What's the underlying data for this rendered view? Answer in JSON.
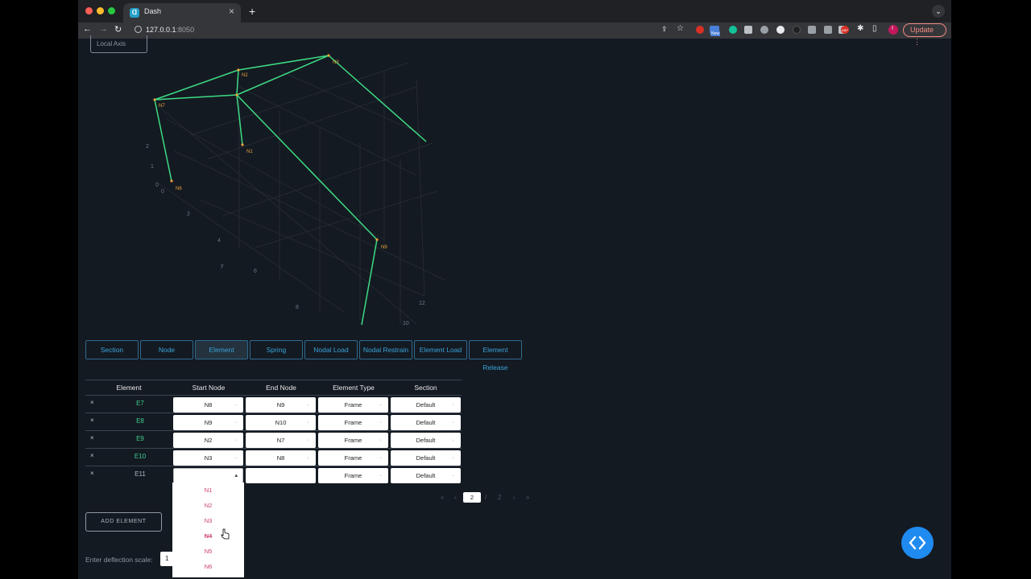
{
  "browser": {
    "tab_title": "Dash",
    "tab_favicon": "Dash",
    "url_host": "127.0.0.1",
    "url_port": ":8050",
    "update_label": "Update",
    "profile_initial": "I",
    "new_badge": "New",
    "abp_badge": "ABP"
  },
  "app": {
    "local_axis_label": "Local Axis",
    "tabs": [
      {
        "label": "Section"
      },
      {
        "label": "Node"
      },
      {
        "label": "Element"
      },
      {
        "label": "Spring"
      },
      {
        "label": "Nodal Load"
      },
      {
        "label": "Nodal Restrain"
      },
      {
        "label": "Element Load"
      },
      {
        "label": "Element Release"
      }
    ],
    "active_tab": "Element",
    "table": {
      "headers": [
        "Element",
        "Start Node",
        "End Node",
        "Element Type",
        "Section"
      ],
      "rows": [
        {
          "element": "E7",
          "start": "N8",
          "end": "N9",
          "type": "Frame",
          "section": "Default"
        },
        {
          "element": "E8",
          "start": "N9",
          "end": "N10",
          "type": "Frame",
          "section": "Default"
        },
        {
          "element": "E9",
          "start": "N2",
          "end": "N7",
          "type": "Frame",
          "section": "Default"
        },
        {
          "element": "E10",
          "start": "N3",
          "end": "N8",
          "type": "Frame",
          "section": "Default"
        },
        {
          "element": "E11",
          "start": "",
          "end": "",
          "type": "Frame",
          "section": "Default"
        }
      ],
      "delete_glyph": "×"
    },
    "dropdown_options": [
      "N1",
      "N2",
      "N3",
      "N4",
      "N5",
      "N6"
    ],
    "pagination": {
      "current_page": "2",
      "first": "«",
      "prev": "‹",
      "slash": "/",
      "total": "2",
      "next": "›",
      "last": "»"
    },
    "add_element_label": "ADD ELEMENT",
    "deflection_label": "Enter deflection scale:",
    "deflection_value": "1"
  },
  "plot": {
    "node_labels": [
      "N7",
      "N2",
      "N3",
      "N1",
      "N6",
      "N9"
    ],
    "axis_ticks": [
      "2",
      "1",
      "0",
      "0",
      "2",
      "4",
      "6",
      "8",
      "y",
      "12",
      "10"
    ]
  },
  "colors": {
    "structure": "#3ddc84",
    "node_label": "#e6a23c",
    "accent": "#3aa3d8",
    "fab": "#1f8bf0"
  }
}
